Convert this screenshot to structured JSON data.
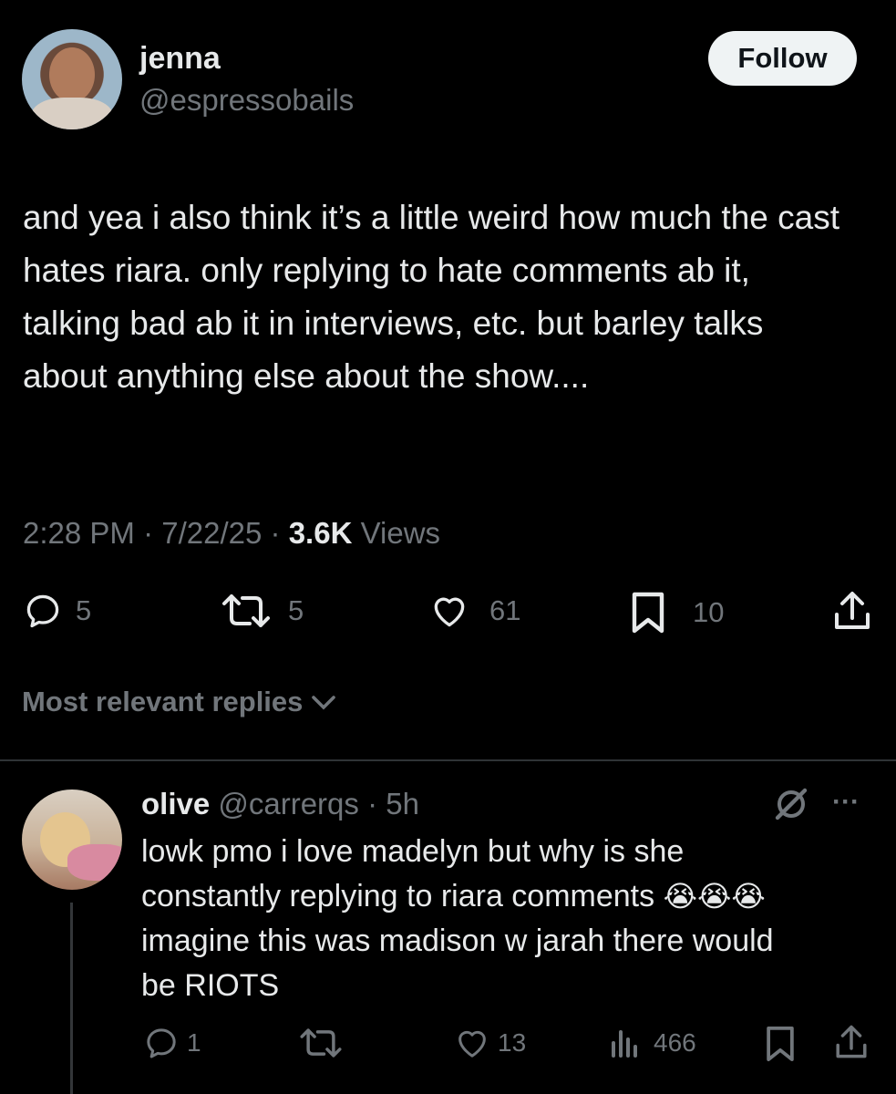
{
  "tweet": {
    "author_name": "jenna",
    "author_handle": "@espressobails",
    "follow_label": "Follow",
    "text": "and yea i also think it’s a little weird how much the cast hates riara. only replying to hate comments ab it, talking bad ab it in interviews, etc. but barley talks about anything else about the show....",
    "time": "2:28 PM",
    "date": "7/22/25",
    "views_count": "3.6K",
    "views_label": "Views",
    "sep": "·",
    "replies": "5",
    "reposts": "5",
    "likes": "61",
    "bookmarks": "10"
  },
  "replies_sort_label": "Most relevant replies",
  "reply": {
    "author_name": "olive",
    "author_handle": "@carrerqs",
    "sep": "·",
    "age": "5h",
    "more": "···",
    "text_line1": "lowk pmo i love madelyn but why is she",
    "text_line2": "constantly replying to riara comments",
    "text_emojis": "😭😭😭",
    "text_line3": "imagine this was madison w jarah there would",
    "text_line4": "be RIOTS",
    "replies": "1",
    "likes": "13",
    "views": "466"
  },
  "colors": {
    "bg": "#000000",
    "text": "#e7e9ea",
    "muted": "#71767b",
    "divider": "#2f3336",
    "follow_bg": "#eff3f4"
  },
  "icons": [
    "reply-icon",
    "repost-icon",
    "like-icon",
    "bookmark-icon",
    "share-icon",
    "views-icon",
    "grok-icon",
    "chevron-down-icon"
  ]
}
